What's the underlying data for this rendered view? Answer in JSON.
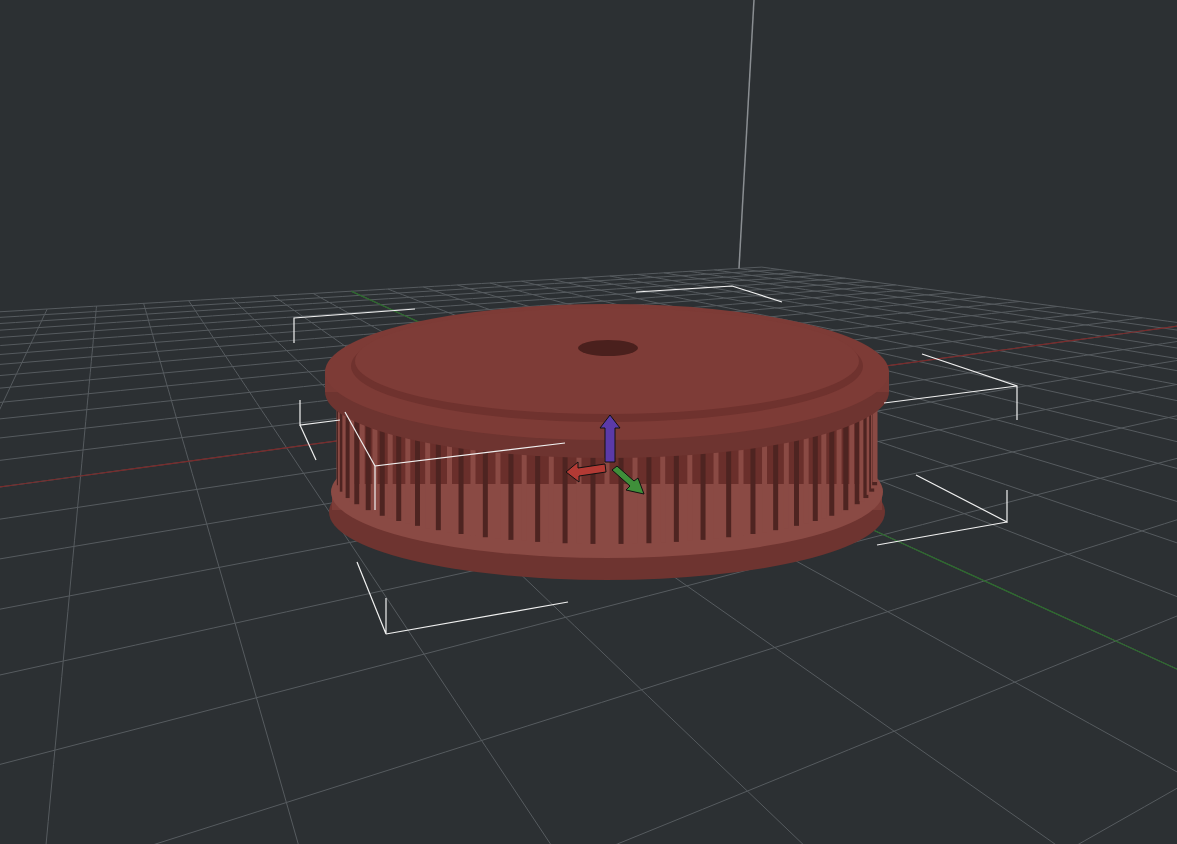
{
  "model": {
    "selected": true
  }
}
